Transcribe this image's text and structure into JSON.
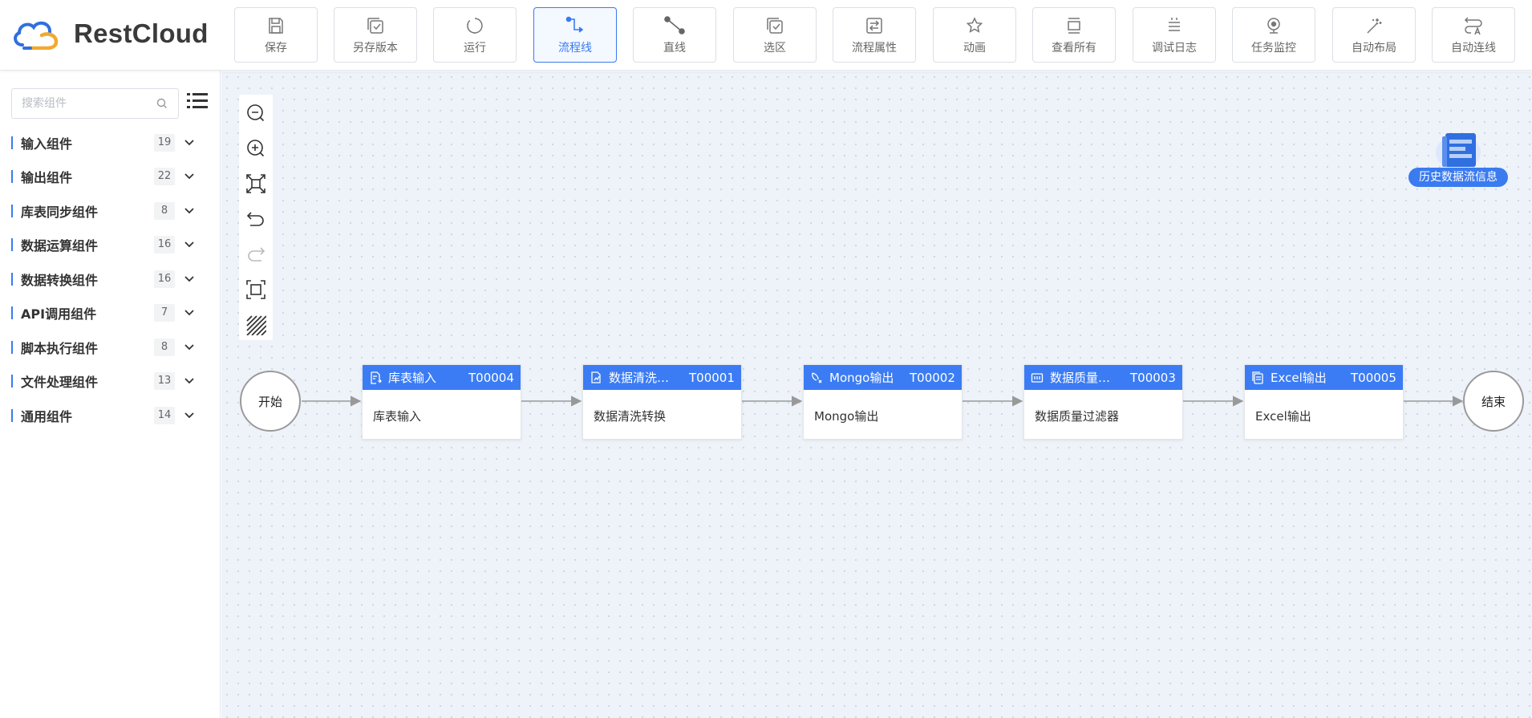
{
  "app": {
    "logo_text": "RestCloud",
    "accent": "#3a7bf0"
  },
  "toolbar": [
    {
      "label": "保存",
      "icon": "save-icon"
    },
    {
      "label": "另存版本",
      "icon": "save-version-icon"
    },
    {
      "label": "运行",
      "icon": "run-icon"
    },
    {
      "label": "流程线",
      "icon": "flow-line-icon",
      "active": true
    },
    {
      "label": "直线",
      "icon": "straight-line-icon"
    },
    {
      "label": "选区",
      "icon": "selection-icon"
    },
    {
      "label": "流程属性",
      "icon": "flow-properties-icon"
    },
    {
      "label": "动画",
      "icon": "animation-icon"
    },
    {
      "label": "查看所有",
      "icon": "view-all-icon"
    },
    {
      "label": "调试日志",
      "icon": "debug-log-icon"
    },
    {
      "label": "任务监控",
      "icon": "task-monitor-icon"
    },
    {
      "label": "自动布局",
      "icon": "auto-layout-icon"
    },
    {
      "label": "自动连线",
      "icon": "auto-connect-icon"
    }
  ],
  "sidebar": {
    "search_placeholder": "搜索组件",
    "categories": [
      {
        "label": "输入组件",
        "count": "19"
      },
      {
        "label": "输出组件",
        "count": "22"
      },
      {
        "label": "库表同步组件",
        "count": "8"
      },
      {
        "label": "数据运算组件",
        "count": "16"
      },
      {
        "label": "数据转换组件",
        "count": "16"
      },
      {
        "label": "API调用组件",
        "count": "7"
      },
      {
        "label": "脚本执行组件",
        "count": "8"
      },
      {
        "label": "文件处理组件",
        "count": "13"
      },
      {
        "label": "通用组件",
        "count": "14"
      }
    ]
  },
  "canvas": {
    "start_label": "开始",
    "end_label": "结束",
    "history_label": "历史数据流信息",
    "nodes": [
      {
        "title": "库表输入",
        "id": "T00004",
        "body": "库表输入"
      },
      {
        "title": "数据清洗…",
        "id": "T00001",
        "body": "数据清洗转换"
      },
      {
        "title": "Mongo输出",
        "id": "T00002",
        "body": "Mongo输出"
      },
      {
        "title": "数据质量…",
        "id": "T00003",
        "body": "数据质量过滤器"
      },
      {
        "title": "Excel输出",
        "id": "T00005",
        "body": "Excel输出"
      }
    ]
  }
}
